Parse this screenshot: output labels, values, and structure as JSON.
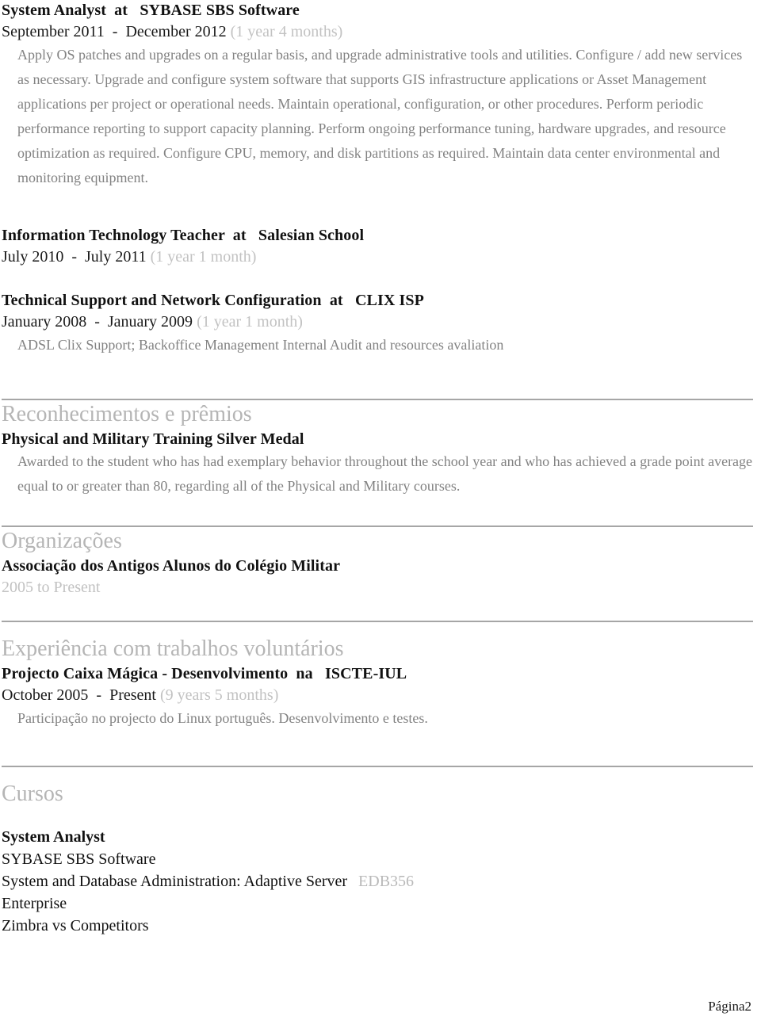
{
  "document": {
    "page_footer": "Página2",
    "colors": {
      "section_heading": "#b5b5b5",
      "body_text": "#828282",
      "duration_text": "#c2c2c2",
      "rule": "#a6a6a6",
      "course_code": "#b9b9b9"
    }
  },
  "experience": [
    {
      "title": "System Analyst  at   SYBASE SBS Software",
      "dates": "September 2011  -  December 2012 ",
      "duration": "(1 year 4 months)",
      "description": "Apply OS patches and upgrades on a regular basis, and upgrade administrative tools and utilities. Configure / add new services as necessary.  Upgrade and configure system software that supports GIS infrastructure applications or Asset Management applications per project or operational needs.  Maintain operational, configuration, or other procedures.  Perform periodic performance reporting to support capacity planning.  Perform ongoing performance tuning, hardware upgrades, and resource optimization as required.  Configure CPU, memory, and disk partitions as required.  Maintain data center environmental and monitoring equipment."
    },
    {
      "title": "Information Technology Teacher  at   Salesian School",
      "dates": "July 2010  -  July 2011 ",
      "duration": "(1 year 1 month)",
      "description": ""
    },
    {
      "title": "Technical Support and Network Configuration  at   CLIX ISP",
      "dates": "January 2008  -  January 2009 ",
      "duration": "(1 year 1 month)",
      "description": "ADSL Clix Support; Backoffice Management Internal Audit and resources avaliation"
    }
  ],
  "sections": {
    "awards": {
      "heading": "Reconhecimentos e prêmios",
      "items": [
        {
          "title": "Physical and Military Training Silver Medal",
          "description": "Awarded to the student who has had exemplary behavior throughout the school year and who has achieved a grade point average equal to or greater than 80, regarding all of the Physical and Military courses."
        }
      ]
    },
    "organizations": {
      "heading": "Organizações",
      "items": [
        {
          "title": "Associação dos Antigos Alunos do Colégio Militar",
          "dates": "2005 to Present"
        }
      ]
    },
    "volunteer": {
      "heading": "Experiência com trabalhos voluntários",
      "items": [
        {
          "title": "Projecto Caixa Mágica - Desenvolvimento  na   ISCTE-IUL",
          "dates": "October 2005  -  Present ",
          "duration": "(9 years 5 months)",
          "description": "Participação no projecto do Linux português. Desenvolvimento e testes."
        }
      ]
    },
    "courses": {
      "heading": "Cursos",
      "items": [
        {
          "name": "System Analyst",
          "org": "SYBASE SBS Software",
          "desc_line1": "System and Database Administration: Adaptive Server",
          "code": "EDB356",
          "desc_line2": "Enterprise",
          "desc_line3": "Zimbra vs Competitors"
        }
      ]
    }
  }
}
